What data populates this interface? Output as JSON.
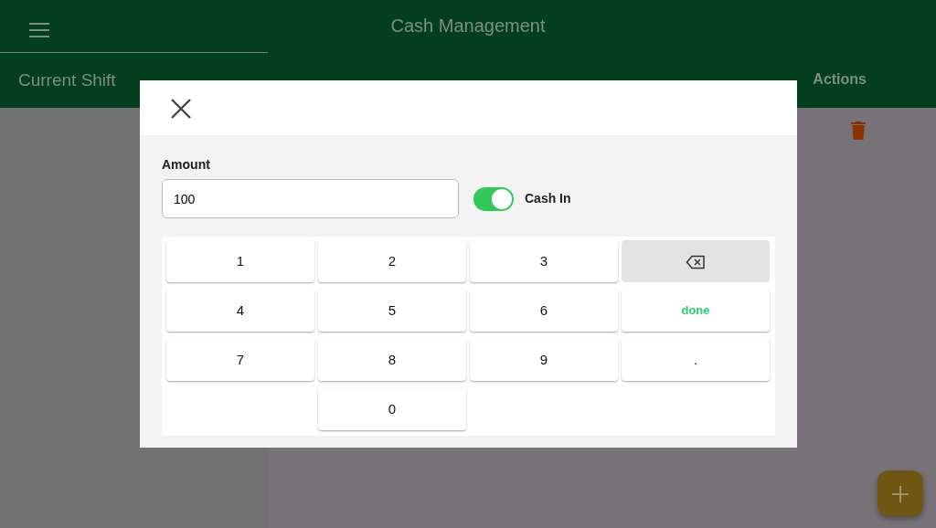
{
  "header": {
    "title": "Cash Management"
  },
  "sidebar": {
    "title": "Current Shift"
  },
  "table": {
    "columns": [
      "Actions"
    ]
  },
  "dialog": {
    "field": {
      "label": "Amount",
      "value": "100"
    },
    "toggle": {
      "label": "Cash In",
      "on": true
    },
    "keys": [
      {
        "kind": "digit",
        "label": "1"
      },
      {
        "kind": "digit",
        "label": "2"
      },
      {
        "kind": "digit",
        "label": "3"
      },
      {
        "kind": "backspace"
      },
      {
        "kind": "digit",
        "label": "4"
      },
      {
        "kind": "digit",
        "label": "5"
      },
      {
        "kind": "digit",
        "label": "6"
      },
      {
        "kind": "done",
        "label": "done"
      },
      {
        "kind": "digit",
        "label": "7"
      },
      {
        "kind": "digit",
        "label": "8"
      },
      {
        "kind": "digit",
        "label": "9"
      },
      {
        "kind": "digit",
        "label": "."
      },
      {
        "kind": "blank"
      },
      {
        "kind": "digit",
        "label": "0"
      },
      {
        "kind": "blank"
      },
      {
        "kind": "blank"
      }
    ]
  }
}
